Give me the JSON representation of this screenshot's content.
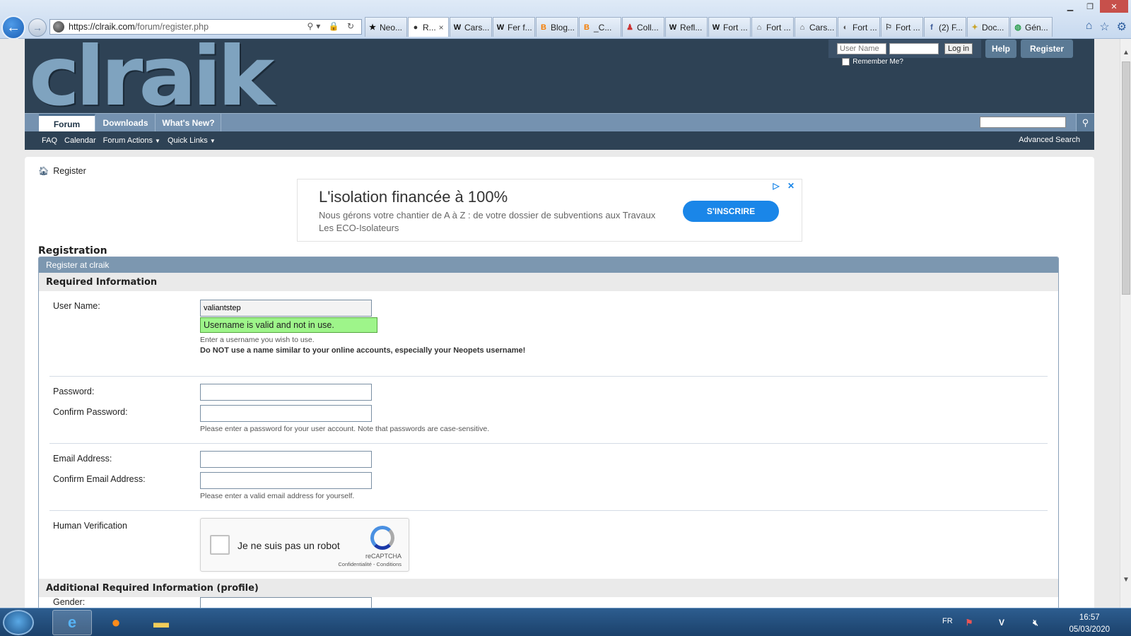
{
  "browser": {
    "url_prefix": "https://",
    "url_host": "clraik.com",
    "url_path": "/forum/register.php",
    "tabs": [
      {
        "label": "Neo...",
        "icon": "★",
        "color": "#111"
      },
      {
        "label": "R...",
        "icon": "●",
        "color": "#333",
        "active": true
      },
      {
        "label": "Cars...",
        "icon": "W",
        "color": "#111"
      },
      {
        "label": "Fer f...",
        "icon": "W",
        "color": "#111"
      },
      {
        "label": "Blog...",
        "icon": "B",
        "color": "#f57d00"
      },
      {
        "label": "_C...",
        "icon": "B",
        "color": "#f57d00"
      },
      {
        "label": "Coll...",
        "icon": "♟",
        "color": "#c33"
      },
      {
        "label": "Refl...",
        "icon": "W",
        "color": "#111"
      },
      {
        "label": "Fort ...",
        "icon": "W",
        "color": "#111"
      },
      {
        "label": "Fort ...",
        "icon": "⌂",
        "color": "#555"
      },
      {
        "label": "Cars...",
        "icon": "⌂",
        "color": "#555"
      },
      {
        "label": "Fort ...",
        "icon": "◐",
        "color": "#555"
      },
      {
        "label": "Fort ...",
        "icon": "⚐",
        "color": "#333"
      },
      {
        "label": "(2) F...",
        "icon": "f",
        "color": "#3b5998"
      },
      {
        "label": "Doc...",
        "icon": "✦",
        "color": "#c9a52d"
      },
      {
        "label": "Gén...",
        "icon": "◍",
        "color": "#2a9d4b"
      }
    ],
    "tab_close": "×"
  },
  "forum": {
    "logo_text": "clraik",
    "login": {
      "username_placeholder": "User Name",
      "login_label": "Log in",
      "remember_label": "Remember Me?"
    },
    "help_label": "Help",
    "register_label": "Register",
    "nav_tabs": [
      "Forum",
      "Downloads",
      "What's New?"
    ],
    "sub_nav": [
      "FAQ",
      "Calendar",
      "Forum Actions",
      "Quick Links"
    ],
    "advanced_search": "Advanced Search"
  },
  "breadcrumb": {
    "current": "Register"
  },
  "ad": {
    "title": "L'isolation financée à 100%",
    "text": "Nous gérons votre chantier de A à Z : de votre dossier de subventions aux Travaux Les ECO-Isolateurs",
    "cta": "S'INSCRIRE",
    "choices": "▷ ✕"
  },
  "registration": {
    "heading": "Registration",
    "block_title": "Register at clraik",
    "required_title": "Required Information",
    "username_label": "User Name:",
    "username_value": "valiantstep",
    "username_valid": "Username is valid and not in use.",
    "username_hint": "Enter a username you wish to use.",
    "username_warning": "Do NOT use a name similar to your online accounts, especially your Neopets username!",
    "password_label": "Password:",
    "confirm_password_label": "Confirm Password:",
    "password_hint": "Please enter a password for your user account. Note that passwords are case-sensitive.",
    "email_label": "Email Address:",
    "confirm_email_label": "Confirm Email Address:",
    "email_hint": "Please enter a valid email address for yourself.",
    "human_label": "Human Verification",
    "captcha_text": "Je ne suis pas un robot",
    "captcha_brand": "reCAPTCHA",
    "captcha_terms": "Confidentialité - Conditions",
    "additional_title": "Additional Required Information (profile)",
    "gender_label": "Gender:"
  },
  "taskbar": {
    "lang": "FR",
    "time": "16:57",
    "date": "05/03/2020"
  },
  "colors": {
    "forum_dark": "#2e4255",
    "nav_blue": "#7592b0",
    "valid_green": "#9ef58a",
    "ad_button": "#1a86e8"
  }
}
